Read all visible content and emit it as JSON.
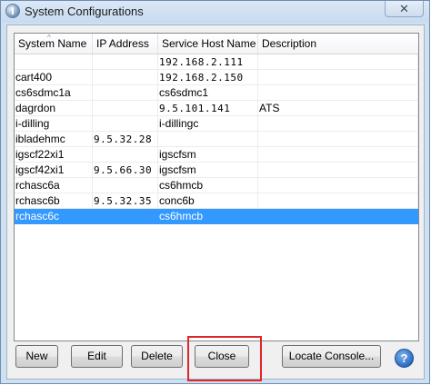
{
  "window": {
    "title": "System Configurations",
    "close_glyph": "✕",
    "app_icon": "info-icon"
  },
  "table": {
    "columns": [
      "System Name",
      "IP Address",
      "Service Host Name",
      "Description"
    ],
    "sort_indicator": "^",
    "rows": [
      {
        "system_name": "",
        "ip_address": "",
        "service_host": "192.168.2.111",
        "description": ""
      },
      {
        "system_name": "cart400",
        "ip_address": "",
        "service_host": "192.168.2.150",
        "description": ""
      },
      {
        "system_name": "cs6sdmc1a",
        "ip_address": "",
        "service_host": "cs6sdmc1",
        "description": ""
      },
      {
        "system_name": "dagrdon",
        "ip_address": "",
        "service_host": "9.5.101.141",
        "description": "ATS"
      },
      {
        "system_name": "i-dilling",
        "ip_address": "",
        "service_host": "i-dillingc",
        "description": ""
      },
      {
        "system_name": "ibladehmc",
        "ip_address": "9.5.32.28",
        "service_host": "",
        "description": ""
      },
      {
        "system_name": "igscf22xi1",
        "ip_address": "",
        "service_host": "igscfsm",
        "description": ""
      },
      {
        "system_name": "igscf42xi1",
        "ip_address": "9.5.66.30",
        "service_host": "igscfsm",
        "description": ""
      },
      {
        "system_name": "rchasc6a",
        "ip_address": "",
        "service_host": "cs6hmcb",
        "description": ""
      },
      {
        "system_name": "rchasc6b",
        "ip_address": "9.5.32.35",
        "service_host": "conc6b",
        "description": ""
      },
      {
        "system_name": "rchasc6c",
        "ip_address": "",
        "service_host": "cs6hmcb",
        "description": "",
        "selected": true
      }
    ]
  },
  "buttons": {
    "new": "New",
    "edit": "Edit",
    "delete": "Delete",
    "close": "Close",
    "locate_console": "Locate Console...",
    "help": "?"
  },
  "colors": {
    "selection": "#3399ff",
    "highlight_box": "#e0262b",
    "window_frame": "#cfe0f1"
  }
}
